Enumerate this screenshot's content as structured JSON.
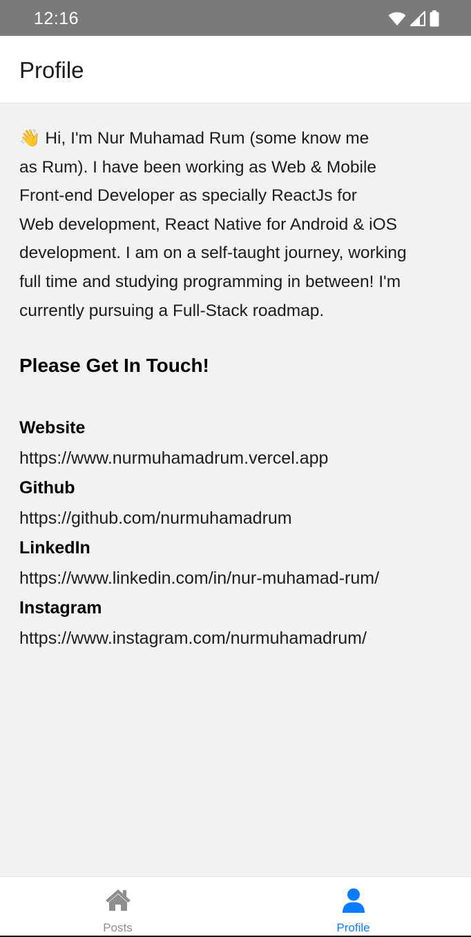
{
  "status_bar": {
    "time": "12:16",
    "icons": [
      "wifi-icon",
      "signal-icon",
      "battery-icon"
    ]
  },
  "header": {
    "title": "Profile"
  },
  "bio": {
    "emoji": "👋",
    "text": " Hi, I'm Nur Muhamad Rum (some know me\nas Rum). I have been working as Web & Mobile\nFront-end Developer as specially ReactJs for\nWeb development, React Native for Android & iOS\ndevelopment. I am on a self-taught journey, working\nfull time and studying programming in between! I'm\ncurrently pursuing a Full-Stack roadmap."
  },
  "contact_heading": "Please Get In Touch!",
  "contacts": [
    {
      "label": "Website",
      "url": "https://www.nurmuhamadrum.vercel.app"
    },
    {
      "label": "Github",
      "url": "https://github.com/nurmuhamadrum"
    },
    {
      "label": "LinkedIn",
      "url": "https://www.linkedin.com/in/nur-muhamad-rum/"
    },
    {
      "label": "Instagram",
      "url": "https://www.instagram.com/nurmuhamadrum/"
    }
  ],
  "tabs": [
    {
      "label": "Posts",
      "icon": "home-icon",
      "active": false,
      "color": "#8e8e8e"
    },
    {
      "label": "Profile",
      "icon": "person-icon",
      "active": true,
      "color": "#0a7cff"
    }
  ],
  "colors": {
    "status_bar": "#7a7a7a",
    "background": "#f2f2f2",
    "active_tab": "#0a7cff",
    "inactive_tab": "#8e8e8e"
  }
}
